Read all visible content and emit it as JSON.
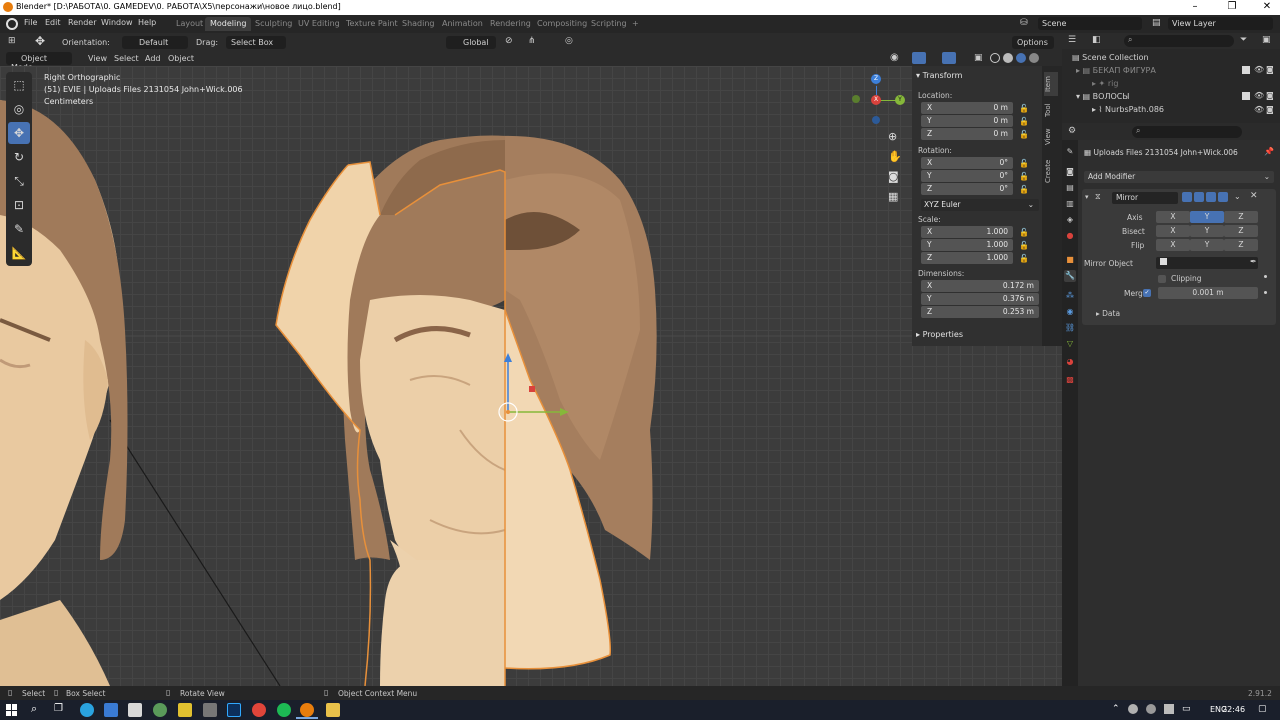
{
  "window": {
    "title": "Blender* [D:\\РАБОТА\\0. GAMEDEV\\0. РАБОТА\\X5\\персонажи\\новое лицо.blend]",
    "controls": [
      "–",
      "❐",
      "✕"
    ]
  },
  "menubar": {
    "menus": [
      "File",
      "Edit",
      "Render",
      "Window",
      "Help"
    ],
    "workspaces": [
      "Layout",
      "Modeling",
      "Sculpting",
      "UV Editing",
      "Texture Paint",
      "Shading",
      "Animation",
      "Rendering",
      "Compositing",
      "Scripting"
    ],
    "active_workspace": "Modeling",
    "add_tab": "+",
    "scene": "Scene",
    "view_layer": "View Layer"
  },
  "tool_header": {
    "orientation_label": "Orientation:",
    "orientation_value": "Default",
    "drag_label": "Drag:",
    "drag_value": "Select Box",
    "transform_orientation": "Global",
    "options": "Options"
  },
  "viewport_header": {
    "mode": "Object Mode",
    "menus": [
      "View",
      "Select",
      "Add",
      "Object"
    ]
  },
  "viewport": {
    "view_name": "Right Orthographic",
    "object_info": "(51) EVIE | Uploads Files 2131054 John+Wick.006",
    "units": "Centimeters",
    "gizmo": {
      "z": "Z",
      "y": "Y",
      "x": "X"
    }
  },
  "toolbar": {
    "tools": [
      "select-box",
      "cursor",
      "move",
      "rotate",
      "scale",
      "transform",
      "annotate",
      "measure"
    ],
    "active_tool": "move"
  },
  "npanel": {
    "tabs": [
      "Item",
      "Tool",
      "View",
      "Create"
    ],
    "transform_title": "Transform",
    "location_label": "Location:",
    "location": [
      {
        "axis": "X",
        "value": "0 m"
      },
      {
        "axis": "Y",
        "value": "0 m"
      },
      {
        "axis": "Z",
        "value": "0 m"
      }
    ],
    "rotation_label": "Rotation:",
    "rotation": [
      {
        "axis": "X",
        "value": "0°"
      },
      {
        "axis": "Y",
        "value": "0°"
      },
      {
        "axis": "Z",
        "value": "0°"
      }
    ],
    "rotation_mode": "XYZ Euler",
    "scale_label": "Scale:",
    "scale": [
      {
        "axis": "X",
        "value": "1.000"
      },
      {
        "axis": "Y",
        "value": "1.000"
      },
      {
        "axis": "Z",
        "value": "1.000"
      }
    ],
    "dimensions_label": "Dimensions:",
    "dimensions": [
      {
        "axis": "X",
        "value": "0.172 m"
      },
      {
        "axis": "Y",
        "value": "0.376 m"
      },
      {
        "axis": "Z",
        "value": "0.253 m"
      }
    ],
    "properties_title": "Properties"
  },
  "outliner": {
    "root": "Scene Collection",
    "items": [
      {
        "label": "БЕКАП ФИГУРА",
        "dim": true
      },
      {
        "label": "rig",
        "dim": true
      },
      {
        "label": "ВОЛОСЫ",
        "dim": false
      },
      {
        "label": "NurbsPath.086",
        "dim": false
      }
    ]
  },
  "properties": {
    "object_name": "Uploads Files 2131054 John+Wick.006",
    "add_modifier": "Add Modifier",
    "modifier_name": "Mirror",
    "axis_label": "Axis",
    "bisect_label": "Bisect",
    "flip_label": "Flip",
    "axes": [
      "X",
      "Y",
      "Z"
    ],
    "axis_active": "Y",
    "mirror_object_label": "Mirror Object",
    "clipping_label": "Clipping",
    "merge_label": "Merge",
    "merge_value": "0.001 m",
    "data_label": "Data"
  },
  "statusbar": {
    "select": "Select",
    "box_select": "Box Select",
    "rotate_view": "Rotate View",
    "context_menu": "Object Context Menu",
    "version": "2.91.2"
  },
  "taskbar": {
    "language": "ENG",
    "time": "22:46"
  },
  "colors": {
    "accent": "#4772b3",
    "selection_outline": "#e8903a",
    "skin": "#e9c9a0",
    "hair": "#a07a5a",
    "gizmo_x": "#d9423c",
    "gizmo_y": "#86b83a",
    "gizmo_z": "#3c7fd9"
  }
}
